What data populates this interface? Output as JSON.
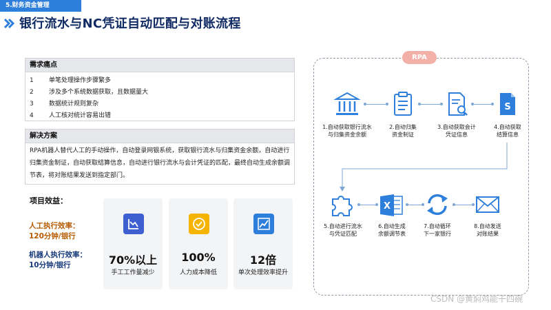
{
  "header": {
    "tag": "5.财务资金管理",
    "title": "银行流水与NC凭证自动匹配与对账流程"
  },
  "pain_points": {
    "heading": "需求痛点",
    "items": [
      {
        "num": "1",
        "text": "单笔处理操作步骤繁多"
      },
      {
        "num": "2",
        "text": "涉及多个系统数据获取，且数据量大"
      },
      {
        "num": "3",
        "text": "数据统计规则复杂"
      },
      {
        "num": "4",
        "text": "人工核对统计容易出错"
      }
    ]
  },
  "solution": {
    "heading": "解决方案",
    "text": "RPA机器人替代人工的手动操作，自动登录网银系统，获取银行流水与归集资金余额，自动进行归集资金制证，自动获取结算信息，自动进行银行流水与会计凭证的匹配，最终自动生成余额调节表，将对账结果发送到指定部门。"
  },
  "benefits": {
    "label": "项目效益：",
    "manual": {
      "line1": "人工执行效率：",
      "line2": "120分钟/银行"
    },
    "robot": {
      "line1": "机器人执行效率：",
      "line2": "10分钟/银行"
    },
    "cards": [
      {
        "value": "70%以上",
        "desc": "手工工作量减少",
        "icon": "chart-down-icon",
        "color": "#3d5fd0"
      },
      {
        "value": "100%",
        "desc": "人力成本降低",
        "icon": "check-circle-icon",
        "color": "#f5b400"
      },
      {
        "value": "12倍",
        "desc": "单次处理效率提升",
        "icon": "chart-up-icon",
        "color": "#2e7fdc"
      }
    ]
  },
  "rpa": {
    "badge": "RPA",
    "steps": [
      {
        "label": "1.自动获取银行流水\n与归集资金余额",
        "icon": "bank-icon"
      },
      {
        "label": "2.自动归集\n资金制证",
        "icon": "clipboard-icon"
      },
      {
        "label": "3.自动获取会计\n凭证信息",
        "icon": "document-search-icon"
      },
      {
        "label": "4.自动获取\n结算信息",
        "icon": "dollar-file-icon"
      },
      {
        "label": "5.自动进行流水\n与凭证匹配",
        "icon": "puzzle-icon"
      },
      {
        "label": "6.自动生成\n余额调节表",
        "icon": "excel-icon"
      },
      {
        "label": "7.自动循环\n下一家银行",
        "icon": "refresh-icon"
      },
      {
        "label": "8.自动发送\n对账结果",
        "icon": "mail-icon"
      }
    ]
  },
  "watermark": "CSDN @黄焖鸡能干四碗",
  "colors": {
    "accent": "#2e7fdc",
    "title": "#102a63",
    "rpa_badge": "#f2b0a8"
  }
}
